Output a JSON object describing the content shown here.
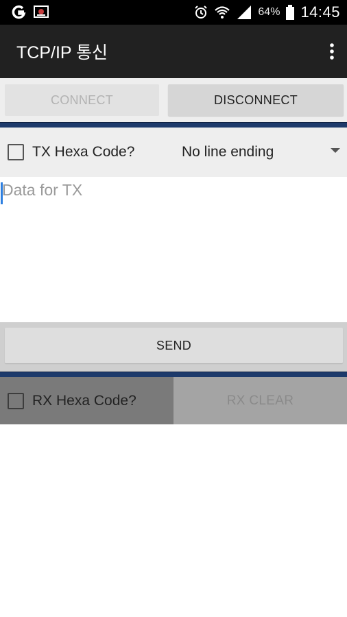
{
  "status_bar": {
    "battery": "64%",
    "time": "14:45"
  },
  "app_bar": {
    "title": "TCP/IP 통신"
  },
  "connection": {
    "connect_label": "CONNECT",
    "disconnect_label": "DISCONNECT"
  },
  "tx_options": {
    "hexa_label": "TX Hexa Code?",
    "hexa_checked": false,
    "line_ending_selected": "No line ending"
  },
  "tx_input": {
    "placeholder": "Data for TX",
    "value": ""
  },
  "send": {
    "label": "SEND"
  },
  "rx_options": {
    "hexa_label": "RX Hexa Code?",
    "hexa_checked": false,
    "clear_label": "RX CLEAR"
  },
  "colors": {
    "app_bar": "#212121",
    "separator": "#1d3a6b",
    "cursor": "#2d7fe0"
  }
}
